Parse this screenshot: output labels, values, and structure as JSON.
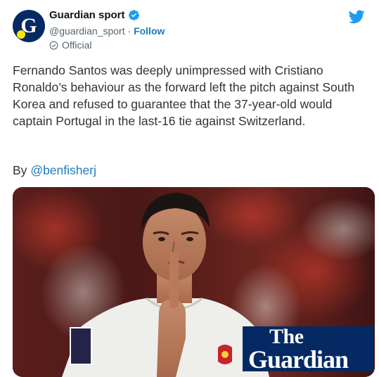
{
  "account": {
    "name": "Guardian sport",
    "handle": "@guardian_sport",
    "separator": "·",
    "follow_label": "Follow",
    "official_label": "Official"
  },
  "tweet": {
    "text": "Fernando Santos was deeply unimpressed with Cristiano Ronaldo’s behaviour as the forward left the pitch against South Korea and refused to guarantee that the 37-year-old would captain Portugal in the last-16 tie against Switzerland.",
    "byline_prefix": "By",
    "byline_mention": "@benfisherj"
  },
  "media": {
    "logo_line1": "The",
    "logo_line2": "Guardian",
    "logo_avatar_letter": "G"
  },
  "colors": {
    "twitter_blue": "#1d9bf0",
    "link_blue": "#1d7bbf",
    "guardian_navy": "#052962",
    "guardian_yellow": "#ffe500"
  },
  "icons": [
    "verified-badge-icon",
    "official-check-icon",
    "twitter-bird-icon"
  ]
}
